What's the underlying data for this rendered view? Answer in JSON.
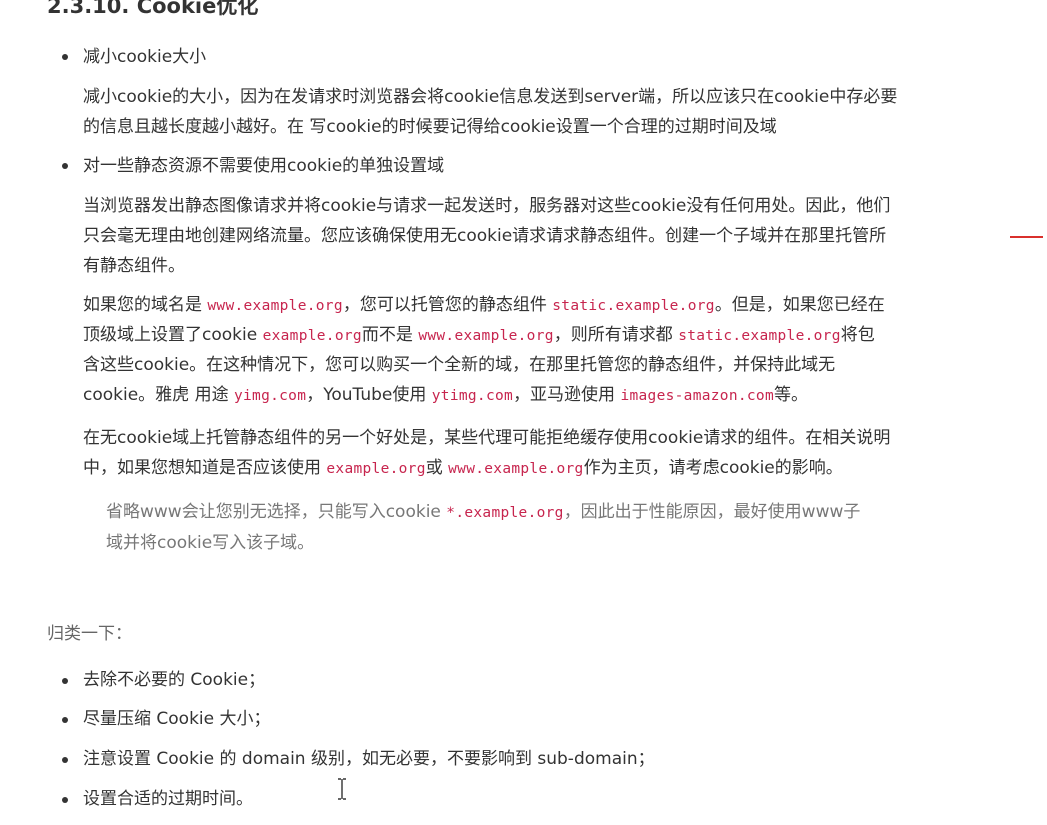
{
  "heading": "2.3.10. Cookie优化",
  "section1": {
    "bullet": "减小cookie大小",
    "lines": [
      "减小cookie的大小，因为在发请求时浏览器会将cookie信息发送到server端，所以应该只在cookie中存必要",
      "的信息且越长度越小越好。在 写cookie的时候要记得给cookie设置一个合理的过期时间及域"
    ]
  },
  "section2": {
    "bullet": "对一些静态资源不需要使用cookie的单独设置域",
    "p1": [
      "当浏览器发出静态图像请求并将cookie与请求一起发送时，服务器对这些cookie没有任何用处。因此，他们",
      "只会毫无理由地创建网络流量。您应该确保使用无cookie请求请求静态组件。创建一个子域并在那里托管所",
      "有静态组件。"
    ],
    "p2": {
      "l1_a": "如果您的域名是 ",
      "l1_code1": "www.example.org",
      "l1_b": "，您可以托管您的静态组件 ",
      "l1_code2": "static.example.org",
      "l1_c": "。但是，如果您已经在",
      "l2_a": "顶级域上设置了cookie ",
      "l2_code1": "example.org",
      "l2_b": "而不是 ",
      "l2_code2": "www.example.org",
      "l2_c": "，则所有请求都 ",
      "l2_code3": "static.example.org",
      "l2_d": "将包",
      "l3": "含这些cookie。在这种情况下，您可以购买一个全新的域，在那里托管您的静态组件，并保持此域无",
      "l4_a": "cookie。雅虎 用途 ",
      "l4_code1": "yimg.com",
      "l4_b": "，YouTube使用 ",
      "l4_code2": "ytimg.com",
      "l4_c": "，亚马逊使用 ",
      "l4_code3": "images-amazon.com",
      "l4_d": "等。"
    },
    "p3": {
      "l1": "在无cookie域上托管静态组件的另一个好处是，某些代理可能拒绝缓存使用cookie请求的组件。在相关说明",
      "l2_a": "中，如果您想知道是否应该使用 ",
      "l2_code1": "example.org",
      "l2_b": "或 ",
      "l2_code2": "www.example.org",
      "l2_c": "作为主页，请考虑cookie的影响。"
    },
    "quote": {
      "l1_a": "省略www会让您别无选择，只能写入cookie ",
      "l1_code": "*.example.org",
      "l1_b": "，因此出于性能原因，最好使用www子",
      "l2": "域并将cookie写入该子域。"
    }
  },
  "summary": {
    "label": "归类一下：",
    "items": [
      "去除不必要的 Cookie；",
      "尽量压缩 Cookie 大小；",
      "注意设置 Cookie 的 domain 级别，如无必要，不要影响到 sub-domain；",
      "设置合适的过期时间。"
    ]
  },
  "colors": {
    "text": "#333333",
    "code": "#c7254e",
    "quote": "#777777",
    "mark": "#d9302c"
  },
  "icons": {
    "cursor": "text-cursor-icon"
  }
}
